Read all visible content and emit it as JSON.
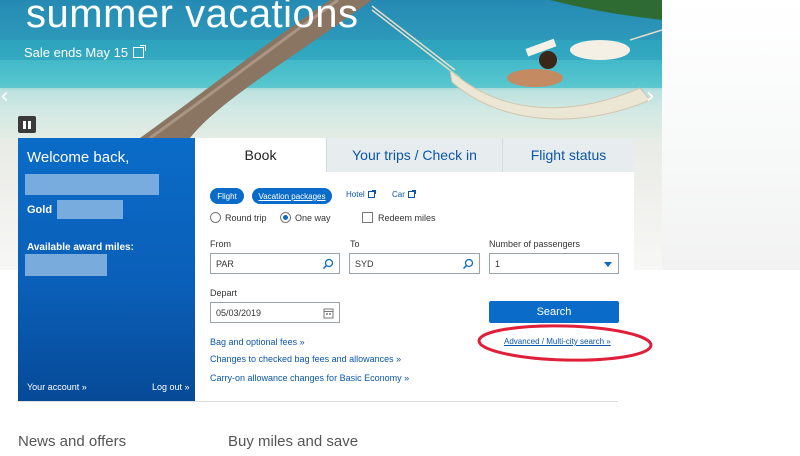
{
  "hero": {
    "title": "summer vacations",
    "subtitle": "Sale ends May 15",
    "prev_arrow": "‹",
    "next_arrow": "›"
  },
  "welcome": {
    "title": "Welcome back,",
    "status": "Gold",
    "award_label": "Available award miles:",
    "account_link": "Your account »",
    "logout_link": "Log out »"
  },
  "tabs": [
    "Book",
    "Your trips / Check in",
    "Flight status"
  ],
  "booking": {
    "types": {
      "flight": "Flight",
      "vacation": "Vacation packages",
      "hotel": "Hotel",
      "car": "Car"
    },
    "trip": {
      "round_trip": "Round trip",
      "one_way": "One way",
      "redeem": "Redeem miles",
      "selected": "One way"
    },
    "from_label": "From",
    "from_value": "PAR",
    "to_label": "To",
    "to_value": "SYD",
    "passengers_label": "Number of passengers",
    "passengers_value": "1",
    "depart_label": "Depart",
    "depart_value": "05/03/2019",
    "search_label": "Search",
    "links": {
      "bag": "Bag and optional fees »",
      "checked": "Changes to checked bag fees and allowances »",
      "carry": "Carry-on allowance changes for Basic Economy »",
      "advanced": "Advanced / Multi-city search »"
    }
  },
  "bottom": {
    "news": "News and offers",
    "buy": "Buy miles and save"
  },
  "colors": {
    "brand_blue": "#0a6cc8",
    "link_blue": "#0b56a8",
    "highlight_red": "#e0203a"
  }
}
